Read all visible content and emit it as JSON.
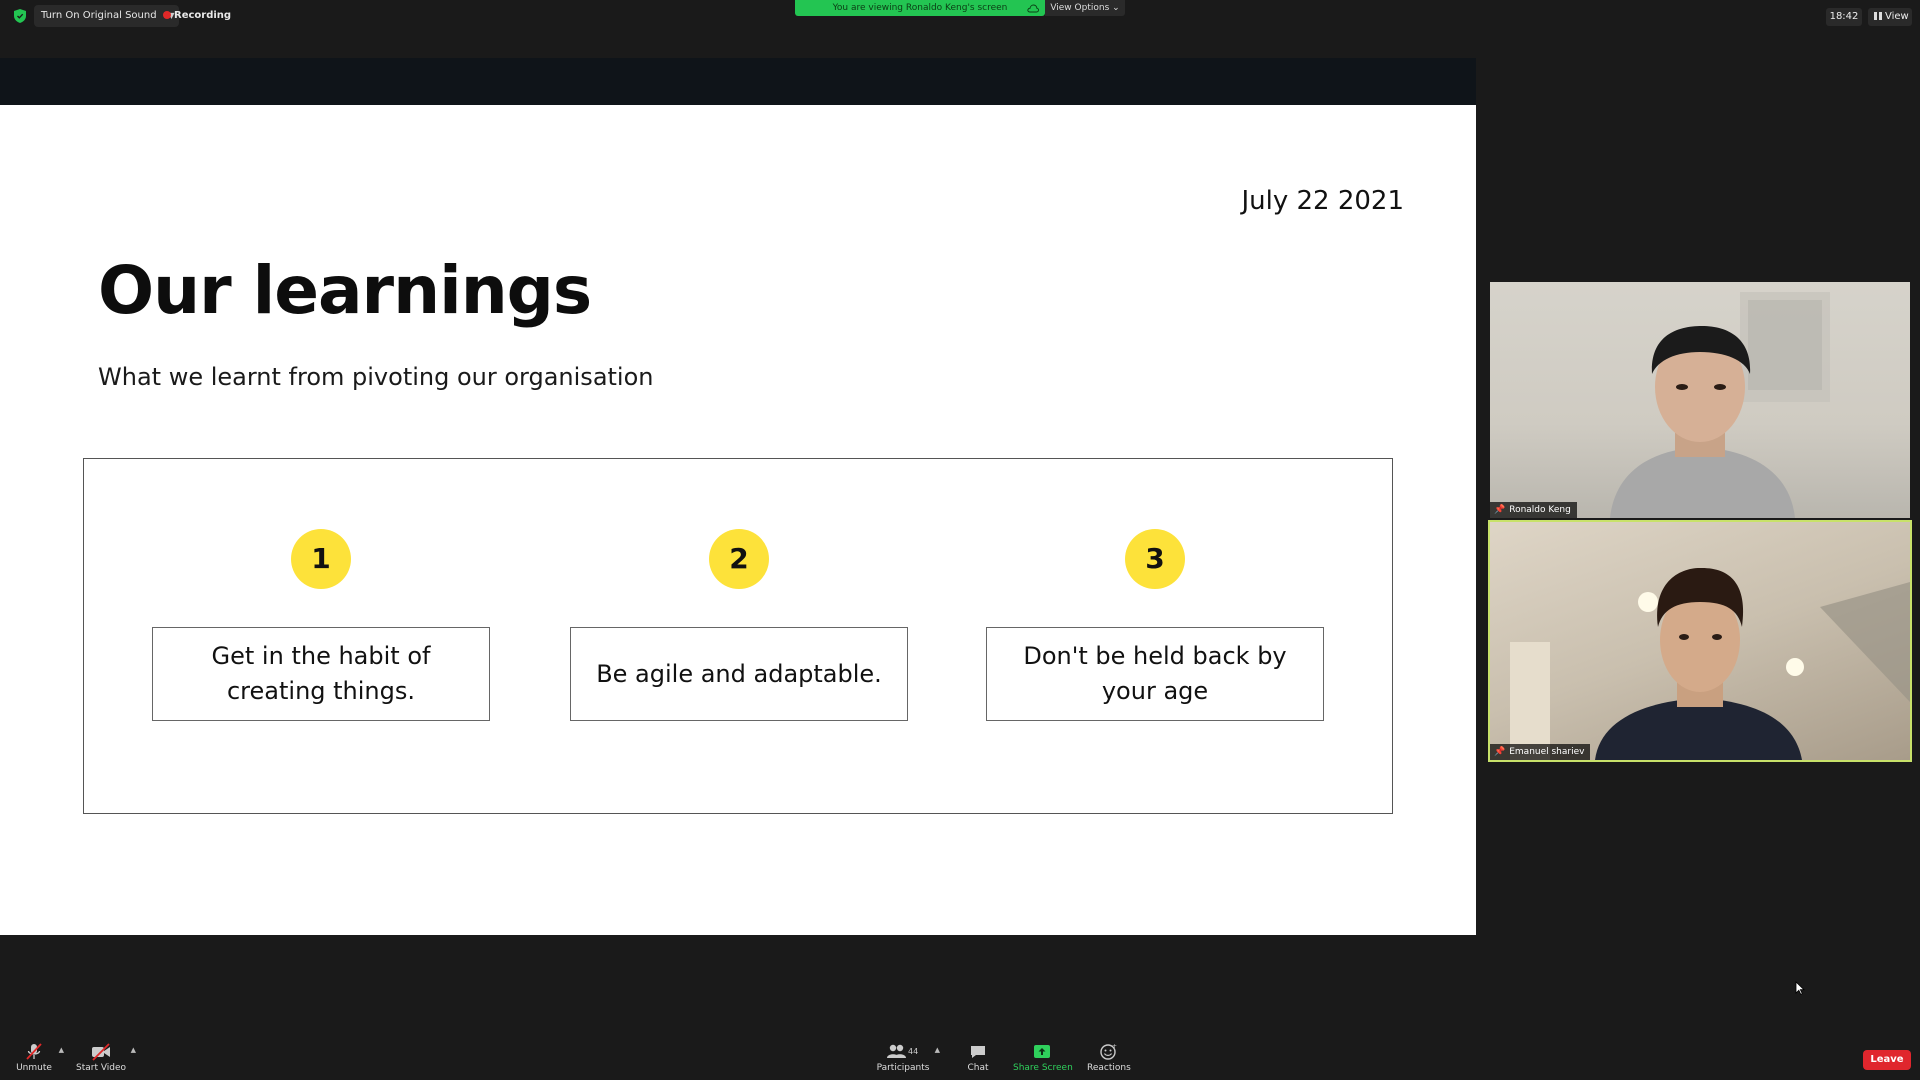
{
  "topbar": {
    "original_sound_label": "Turn On Original Sound",
    "recording_label": "Recording",
    "viewing_banner": "You are viewing Ronaldo Keng's screen",
    "view_options_label": "View Options",
    "clock": "18:42",
    "view_label": "View"
  },
  "slide": {
    "date": "July 22 2021",
    "title": "Our learnings",
    "subtitle": "What we learnt from pivoting our organisation",
    "items": [
      {
        "number": "1",
        "text": "Get in the habit of creating things."
      },
      {
        "number": "2",
        "text": "Be agile and adaptable."
      },
      {
        "number": "3",
        "text": "Don't be held back by your age"
      }
    ]
  },
  "participants_video": [
    {
      "name": "Ronaldo Keng"
    },
    {
      "name": "Emanuel shariev"
    }
  ],
  "toolbar": {
    "unmute_label": "Unmute",
    "start_video_label": "Start Video",
    "participants_label": "Participants",
    "participants_count": "44",
    "chat_label": "Chat",
    "share_screen_label": "Share Screen",
    "reactions_label": "Reactions",
    "leave_label": "Leave"
  },
  "colors": {
    "accent_green": "#23c552",
    "number_badge": "#fde23a",
    "leave_red": "#e0262d",
    "active_speaker_border": "#c8e26a"
  }
}
